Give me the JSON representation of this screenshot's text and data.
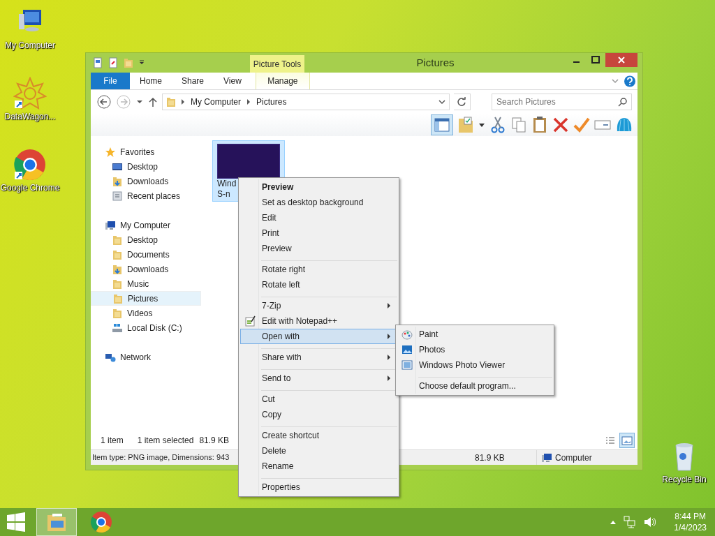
{
  "desktop_icons": [
    {
      "kind": "computer",
      "label": "My Computer"
    },
    {
      "kind": "app",
      "label": "DataWagon..."
    },
    {
      "kind": "chrome",
      "label": "Google Chrome"
    },
    {
      "kind": "recycle",
      "label": "Recycle Bin"
    }
  ],
  "window": {
    "title": "Pictures",
    "contextual_group": "Picture Tools",
    "ribbon_tabs": [
      {
        "kind": "file",
        "label": "File",
        "selected": false
      },
      {
        "kind": "tab",
        "label": "Home",
        "selected": false
      },
      {
        "kind": "tab",
        "label": "Share",
        "selected": false
      },
      {
        "kind": "tab",
        "label": "View",
        "selected": false
      },
      {
        "kind": "contextual",
        "label": "Manage",
        "selected": false
      }
    ],
    "breadcrumb": [
      "My Computer",
      "Pictures"
    ],
    "search": {
      "placeholder": "Search Pictures"
    },
    "preview_pane_on": true,
    "navigation": [
      {
        "kind": "star",
        "label": "Favorites",
        "selected": false,
        "children": [
          {
            "kind": "monitor",
            "label": "Desktop",
            "selected": false
          },
          {
            "kind": "download",
            "label": "Downloads",
            "selected": false
          },
          {
            "kind": "recent",
            "label": "Recent places",
            "selected": false
          }
        ]
      },
      {
        "kind": "computer",
        "label": "My Computer",
        "selected": false,
        "children": [
          {
            "kind": "folder",
            "label": "Desktop",
            "selected": false
          },
          {
            "kind": "folder",
            "label": "Documents",
            "selected": false
          },
          {
            "kind": "download",
            "label": "Downloads",
            "selected": false
          },
          {
            "kind": "folder",
            "label": "Music",
            "selected": false
          },
          {
            "kind": "folder",
            "label": "Pictures",
            "selected": true
          },
          {
            "kind": "folder",
            "label": "Videos",
            "selected": false
          },
          {
            "kind": "disk",
            "label": "Local Disk (C:)",
            "selected": false
          }
        ]
      },
      {
        "kind": "network",
        "label": "Network",
        "selected": false
      }
    ],
    "files": [
      {
        "name_lines": [
          "Wind",
          "S-n"
        ],
        "selected": true
      }
    ],
    "status": {
      "count": "1 item",
      "selection": "1 item selected",
      "size": "81.9 KB"
    },
    "view_buttons": [
      {
        "kind": "details",
        "selected": false
      },
      {
        "kind": "large_icons",
        "selected": true
      }
    ],
    "details_bar": {
      "info": "Item type: PNG image, Dimensions: 943",
      "size": "81.9 KB",
      "location": "Computer"
    }
  },
  "context_menu": [
    {
      "kind": "item",
      "label": "Preview",
      "default": true,
      "highlighted": false,
      "submenu": false
    },
    {
      "kind": "item",
      "label": "Set as desktop background",
      "default": false,
      "highlighted": false,
      "submenu": false
    },
    {
      "kind": "item",
      "label": "Edit",
      "default": false,
      "highlighted": false,
      "submenu": false
    },
    {
      "kind": "item",
      "label": "Print",
      "default": false,
      "highlighted": false,
      "submenu": false
    },
    {
      "kind": "item",
      "label": "Preview",
      "default": false,
      "highlighted": false,
      "submenu": false
    },
    {
      "kind": "separator"
    },
    {
      "kind": "item",
      "label": "Rotate right",
      "default": false,
      "highlighted": false,
      "submenu": false
    },
    {
      "kind": "item",
      "label": "Rotate left",
      "default": false,
      "highlighted": false,
      "submenu": false
    },
    {
      "kind": "separator"
    },
    {
      "kind": "item",
      "label": "7-Zip",
      "default": false,
      "highlighted": false,
      "submenu": true
    },
    {
      "kind": "icon_item",
      "label": "Edit with Notepad++",
      "default": false,
      "highlighted": false,
      "submenu": false
    },
    {
      "kind": "item",
      "label": "Open with",
      "default": false,
      "highlighted": true,
      "submenu": true
    },
    {
      "kind": "separator"
    },
    {
      "kind": "item",
      "label": "Share with",
      "default": false,
      "highlighted": false,
      "submenu": true
    },
    {
      "kind": "separator"
    },
    {
      "kind": "item",
      "label": "Send to",
      "default": false,
      "highlighted": false,
      "submenu": true
    },
    {
      "kind": "separator"
    },
    {
      "kind": "item",
      "label": "Cut",
      "default": false,
      "highlighted": false,
      "submenu": false
    },
    {
      "kind": "item",
      "label": "Copy",
      "default": false,
      "highlighted": false,
      "submenu": false
    },
    {
      "kind": "separator"
    },
    {
      "kind": "item",
      "label": "Create shortcut",
      "default": false,
      "highlighted": false,
      "submenu": false
    },
    {
      "kind": "item",
      "label": "Delete",
      "default": false,
      "highlighted": false,
      "submenu": false
    },
    {
      "kind": "item",
      "label": "Rename",
      "default": false,
      "highlighted": false,
      "submenu": false
    },
    {
      "kind": "separator"
    },
    {
      "kind": "item",
      "label": "Properties",
      "default": false,
      "highlighted": false,
      "submenu": false
    }
  ],
  "open_with_menu": [
    {
      "kind": "icon_item",
      "label": "Paint"
    },
    {
      "kind": "icon_item",
      "label": "Photos"
    },
    {
      "kind": "icon_item",
      "label": "Windows Photo Viewer"
    },
    {
      "kind": "separator"
    },
    {
      "kind": "item",
      "label": "Choose default program..."
    }
  ],
  "taskbar": {
    "apps": [
      {
        "kind": "explorer",
        "active": true
      },
      {
        "kind": "chrome",
        "active": false
      }
    ],
    "time": "8:44 PM",
    "date": "1/4/2023"
  }
}
